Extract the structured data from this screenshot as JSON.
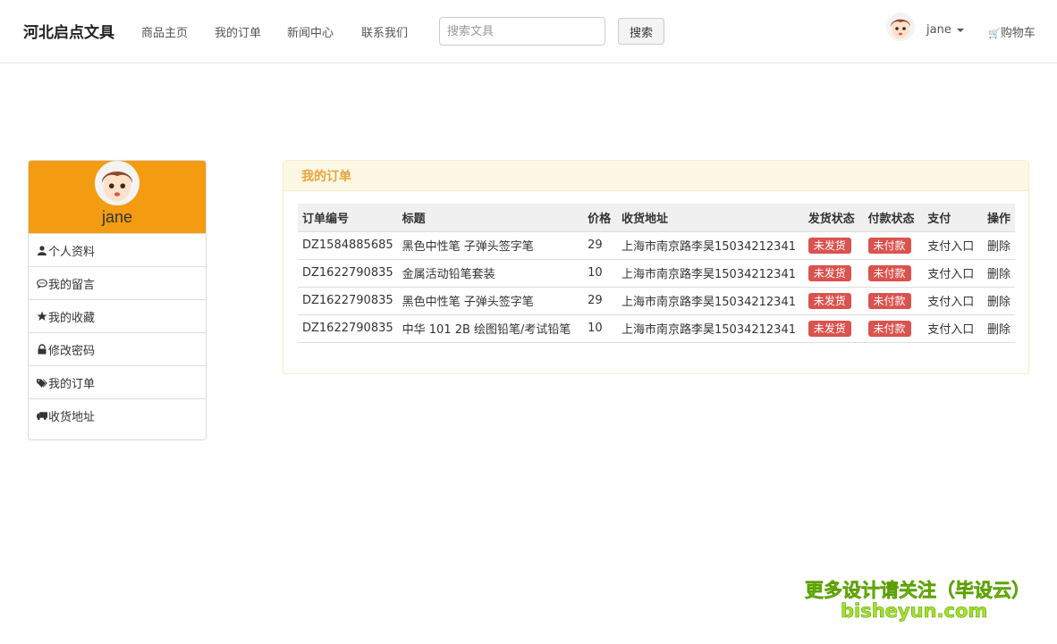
{
  "nav": {
    "brand": "河北启点文具",
    "links": [
      "商品主页",
      "我的订单",
      "新闻中心",
      "联系我们"
    ],
    "search_placeholder": "搜索文具",
    "search_button": "搜索",
    "username": "jane",
    "cart": "购物车"
  },
  "sidebar": {
    "username": "jane",
    "items": [
      {
        "label": "个人资料",
        "icon": "user-icon"
      },
      {
        "label": "我的留言",
        "icon": "comment-icon"
      },
      {
        "label": "我的收藏",
        "icon": "star-icon"
      },
      {
        "label": "修改密码",
        "icon": "lock-icon"
      },
      {
        "label": "我的订单",
        "icon": "tags-icon"
      },
      {
        "label": "收货地址",
        "icon": "truck-icon"
      }
    ]
  },
  "orders": {
    "title": "我的订单",
    "columns": [
      "订单编号",
      "标题",
      "价格",
      "收货地址",
      "发货状态",
      "付款状态",
      "支付",
      "操作"
    ],
    "rows": [
      {
        "id": "DZ1584885685",
        "title": "黑色中性笔 子弹头签字笔",
        "price": "29",
        "address": "上海市南京路李昊15034212341",
        "ship": "未发货",
        "pay": "未付款",
        "pay_link": "支付入口",
        "action": "删除"
      },
      {
        "id": "DZ1622790835",
        "title": "金属活动铅笔套装",
        "price": "10",
        "address": "上海市南京路李昊15034212341",
        "ship": "未发货",
        "pay": "未付款",
        "pay_link": "支付入口",
        "action": "删除"
      },
      {
        "id": "DZ1622790835",
        "title": "黑色中性笔 子弹头签字笔",
        "price": "29",
        "address": "上海市南京路李昊15034212341",
        "ship": "未发货",
        "pay": "未付款",
        "pay_link": "支付入口",
        "action": "删除"
      },
      {
        "id": "DZ1622790835",
        "title": "中华 101 2B 绘图铅笔/考试铅笔",
        "price": "10",
        "address": "上海市南京路李昊15034212341",
        "ship": "未发货",
        "pay": "未付款",
        "pay_link": "支付入口",
        "action": "删除"
      }
    ]
  },
  "watermark": {
    "line1": "更多设计请关注（毕设云）",
    "line2": "bisheyun.com"
  },
  "colors": {
    "profile_header": "#f39c12",
    "panel_heading_text": "#e8a33d",
    "badge": "#d9534f"
  }
}
